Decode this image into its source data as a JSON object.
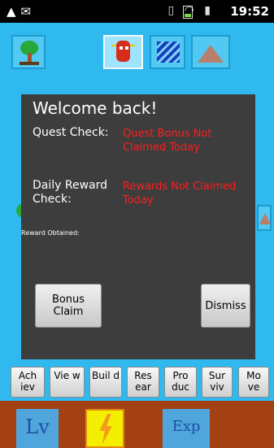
{
  "status_bar": {
    "time": "19:52",
    "left_icons": [
      "warning-icon",
      "message-icon"
    ],
    "right_icons": [
      "vibrate-icon",
      "wifi-icon",
      "signal-icon",
      "battery-icon",
      "alarm-icon"
    ]
  },
  "top_tiles": [
    "tree-icon",
    "robot-icon",
    "water-icon",
    "mountain-icon"
  ],
  "dialog": {
    "title": "Welcome back!",
    "quest_check_label": "Quest Check:",
    "quest_check_value": "Quest Bonus Not Claimed Today",
    "daily_reward_label": "Daily Reward Check:",
    "daily_reward_value": "Rewards Not Claimed Today",
    "reward_obtained_label": "Reward Obtained:",
    "bonus_claim_button": "Bonus Claim",
    "dismiss_button": "Dismiss"
  },
  "menu": [
    {
      "label": "Ach iev"
    },
    {
      "label": "Vie w"
    },
    {
      "label": "Buil d"
    },
    {
      "label": "Res ear"
    },
    {
      "label": "Pro duc"
    },
    {
      "label": "Sur viv"
    },
    {
      "label": "Mo ve"
    }
  ],
  "bottom_bar": {
    "level_label": "Lv",
    "exp_label": "Exp"
  },
  "colors": {
    "background": "#2fb9ee",
    "dialog": "#3d3d3d",
    "status_text": "#ff1d1d",
    "strip": "#a34113"
  }
}
